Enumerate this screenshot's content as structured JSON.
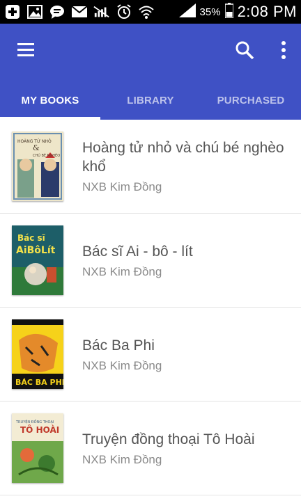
{
  "status_bar": {
    "battery_percent": "35%",
    "time": "2:08 PM",
    "icons": [
      "add-icon",
      "image-icon",
      "chat-icon",
      "mail-icon",
      "signal-off-icon",
      "alarm-icon",
      "wifi-icon",
      "cell-signal-icon",
      "battery-icon"
    ]
  },
  "appbar": {
    "color": "#3f51c5",
    "icons": [
      "menu-icon",
      "search-icon",
      "more-vert-icon"
    ]
  },
  "tabs": [
    {
      "label": "MY BOOKS",
      "active": true
    },
    {
      "label": "LIBRARY",
      "active": false
    },
    {
      "label": "PURCHASED",
      "active": false
    }
  ],
  "books": [
    {
      "title": "Hoàng tử nhỏ và chú bé nghèo khổ",
      "publisher": "NXB Kim Đồng",
      "cover_text": "HOÀNG TỬ NHỎ & CHÚ BÉ NGHÈO KHỔ"
    },
    {
      "title": "Bác sĩ Ai - bô - lít",
      "publisher": "NXB Kim Đồng",
      "cover_text": "Bác sĩ AiBôLít"
    },
    {
      "title": "Bác Ba Phi",
      "publisher": "NXB Kim Đồng",
      "cover_text": "BÁC BA PHI"
    },
    {
      "title": "Truyện đồng thoại Tô Hoài",
      "publisher": "NXB Kim Đồng",
      "cover_text": "TÔ HOÀI"
    }
  ]
}
